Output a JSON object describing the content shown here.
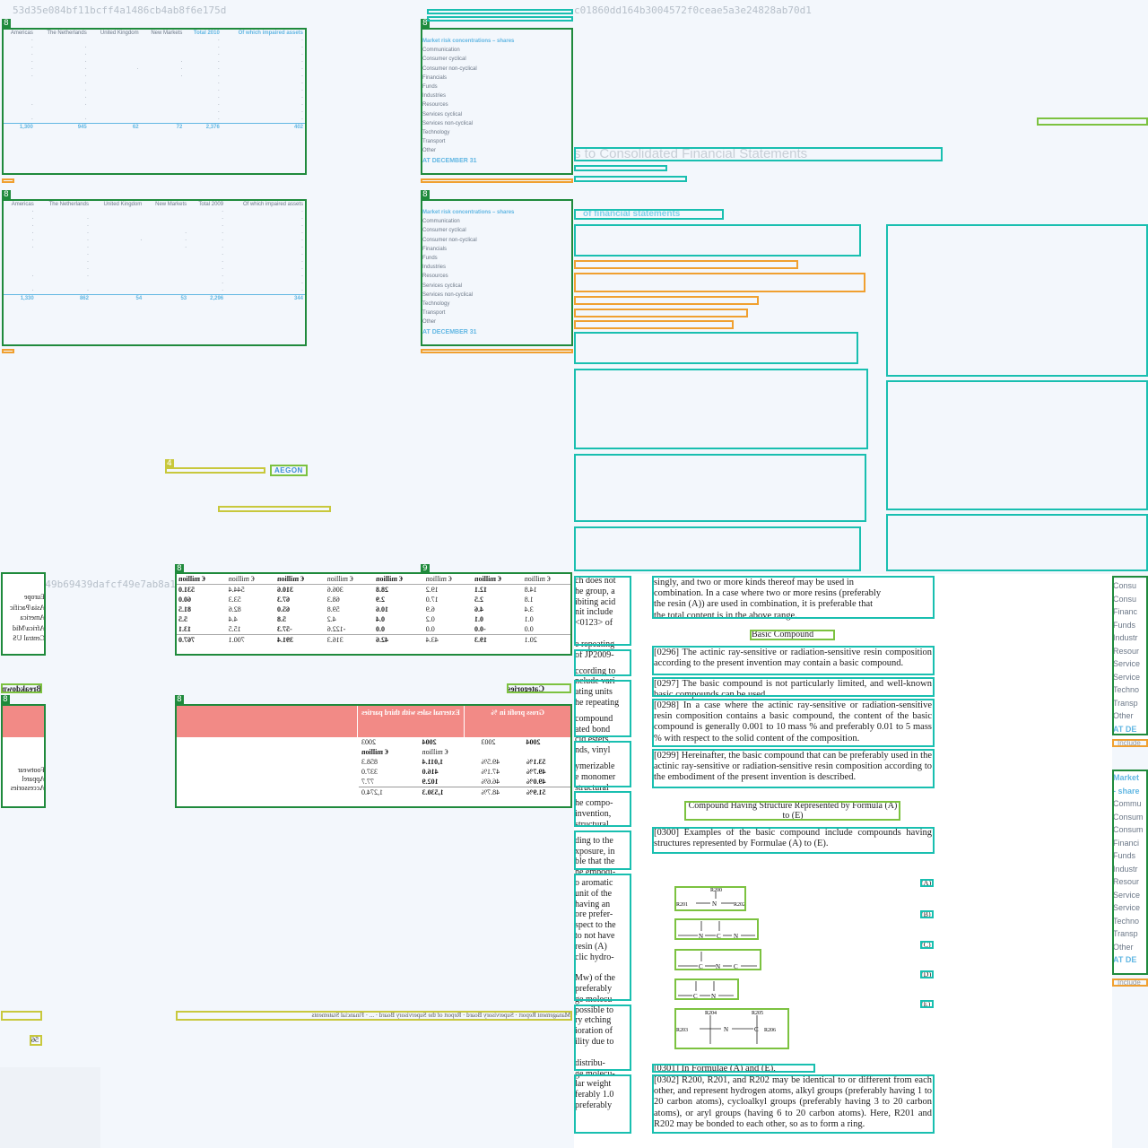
{
  "tiles": {
    "top_left_hash": "53d35e084bf11bcff4a1486cb4ab8f6e175d",
    "top_right_hash": "c01860dd164b3004572f0ceae5a3e24828ab70d1",
    "mid_left_hash": "4b65d0b49b69439dafcf49e7ab8a19e89"
  },
  "region_table_2010": {
    "headers": [
      "Americas",
      "The Netherlands",
      "United Kingdom",
      "New Markets",
      "Total 2010",
      "Of which impaired assets"
    ],
    "total_row": [
      "1,300",
      "945",
      "62",
      "72",
      "2,376",
      "402"
    ]
  },
  "region_table_2009": {
    "headers": [
      "Americas",
      "The Netherlands",
      "United Kingdom",
      "New Markets",
      "Total 2009",
      "Of which impaired assets"
    ],
    "total_row": [
      "1,330",
      "862",
      "54",
      "53",
      "2,296",
      "344"
    ]
  },
  "risk_2010": {
    "title": "Market risk concentrations – shares",
    "items": [
      "Communication",
      "Consumer cyclical",
      "Consumer non-cyclical",
      "Financials",
      "Funds",
      "Industries",
      "Resources",
      "Services cyclical",
      "Services non-cyclical",
      "Technology",
      "Transport",
      "Other"
    ],
    "footer": "AT DECEMBER 31"
  },
  "risk_2009": {
    "title": "Market risk concentrations – shares",
    "items": [
      "Communication",
      "Consumer cyclical",
      "Consumer non-cyclical",
      "Financials",
      "Funds",
      "Industries",
      "Resources",
      "Services cyclical",
      "Services non-cyclical",
      "Technology",
      "Transport",
      "Other"
    ],
    "footer": "AT DECEMBER 31"
  },
  "aegon": {
    "logo": "AEGON"
  },
  "notes": {
    "heading": "s to Consolidated Financial Statements",
    "subheading": "of financial statements"
  },
  "segments": {
    "rows": [
      "Europe",
      "Asia/Pacific",
      "America",
      "Africa/Mid",
      "Central US"
    ],
    "headers": [
      "€ million",
      "€ million",
      "€ million",
      "€ million",
      "€ million",
      "€ million",
      "€ million",
      "€ million"
    ],
    "data": [
      [
        "14.8",
        "12.1",
        "19.2",
        "28.8",
        "306.6",
        "310.6",
        "544.4",
        "531.0"
      ],
      [
        "1.8",
        "2.5",
        "17.0",
        "2.9",
        "68.3",
        "67.3",
        "53.3",
        "60.0"
      ],
      [
        "3.4",
        "4.6",
        "6.9",
        "10.6",
        "59.8",
        "65.0",
        "82.6",
        "81.5"
      ],
      [
        "0.1",
        "0.1",
        "0.2",
        "0.4",
        "4.2",
        "5.8",
        "4.4",
        "5.5"
      ],
      [
        "0.0",
        "-0.0",
        "0.0",
        "0.0",
        "-122.6",
        "-57.3",
        "15.5",
        "13.1"
      ],
      [
        "20.1",
        "19.3",
        "43.4",
        "42.6",
        "316.3",
        "391.4",
        "700.1",
        "767.0"
      ]
    ]
  },
  "categories": {
    "label": "Categories",
    "breakdown_label": "Breakdown",
    "col_gross": "Gross profit in %",
    "col_sales": "External sales with third parties",
    "years": [
      "2004",
      "2003",
      "2004",
      "2003"
    ],
    "unit": "€ million",
    "rows": [
      "Footwear",
      "Apparel",
      "Accessories"
    ],
    "data": [
      [
        "53.1%",
        "49.5%",
        "1,011.4",
        "858.3"
      ],
      [
        "49.7%",
        "47.1%",
        "416.0",
        "337.0"
      ],
      [
        "49.0%",
        "46.6%",
        "102.9",
        "77.7"
      ]
    ],
    "total": [
      "51.9%",
      "48.7%",
      "1,530.3",
      "1,274.0"
    ]
  },
  "report_footer": "Management Report · Supervisory Board · Report of the Supervisory Board · ... · Financial Statements",
  "page_stub": "56",
  "patent": {
    "intro_lines": [
      "singly, and two or more kinds thereof may be used in",
      "combination. In a case where two or more resins (preferably",
      "the resin (A)) are used in combination, it is preferable that",
      "the total content is in the above range."
    ],
    "basic_compound_heading": "Basic Compound",
    "p0296": "[0296] The actinic ray-sensitive or radiation-sensitive resin composition according to the present invention may contain a basic compound.",
    "p0297": "[0297] The basic compound is not particularly limited, and well-known basic compounds can be used.",
    "p0298": "[0298] In a case where the actinic ray-sensitive or radiation-sensitive resin composition contains a basic compound, the content of the basic compound is generally 0.001 to 10 mass % and preferably 0.01 to 5 mass % with respect to the solid content of the composition.",
    "p0299": "[0299] Hereinafter, the basic compound that can be preferably used in the actinic ray-sensitive or radiation-sensitive resin composition according to the embodiment of the present invention is described.",
    "structure_heading": "Compound Having Structure Represented by Formula (A) to (E)",
    "p0300": "[0300] Examples of the basic compound include compounds having structures represented by Formulae (A) to (E).",
    "p0301": "[0301] In Formulae (A) and (E),",
    "p0302": "[0302] R200, R201, and R202 may be identical to or different from each other, and represent hydrogen atoms, alkyl groups (preferably having 1 to 20 carbon atoms), cycloalkyl groups (preferably having 3 to 20 carbon atoms), or aryl groups (having 6 to 20 carbon atoms). Here, R201 and R202 may be bonded to each other, so as to form a ring.",
    "formula_labels": [
      "(A)",
      "(B)",
      "(C)",
      "(D)",
      "(E)"
    ],
    "left_column": [
      "ch does not",
      "he group, a",
      "ibiting acid",
      "nit include",
      "<0123> of",
      "e repeating",
      "of JP2009-",
      "ccording to",
      "nclude vari-",
      "ating units",
      "he repeating",
      "compound",
      "ated bond",
      "cid esters,",
      "nds, vinyl",
      "ymerizable",
      "e monomer",
      "structural",
      "he compo-",
      "invention,",
      "structural",
      "ding to the",
      "xposure, in",
      "ble that the",
      "he embodi-",
      "o aromatic",
      "unit of the",
      "having an",
      "ore prefer-",
      "spect to the",
      "to not have",
      "resin (A)",
      "clic hydro-",
      "Mw) of the",
      "preferably",
      "ge molecu-",
      "possible to",
      "ry etching",
      "ioration of",
      "ility due to",
      "distribu-",
      "ge molecu-",
      "lar weight",
      "ferably 1.0",
      "preferably"
    ]
  },
  "right_risk": {
    "items": [
      "Consu",
      "Consu",
      "Financ",
      "Funds",
      "Industr",
      "Resour",
      "Service",
      "Service",
      "Techno",
      "Transp",
      "Other",
      "AT DE"
    ],
    "items2": [
      "Market",
      "- share",
      "Commu",
      "Consum",
      "Consum",
      "Financi",
      "Funds",
      "Industr",
      "Resour",
      "Service",
      "Service",
      "Techno",
      "Transp",
      "Other",
      "AT DE"
    ],
    "tag": "Include"
  }
}
